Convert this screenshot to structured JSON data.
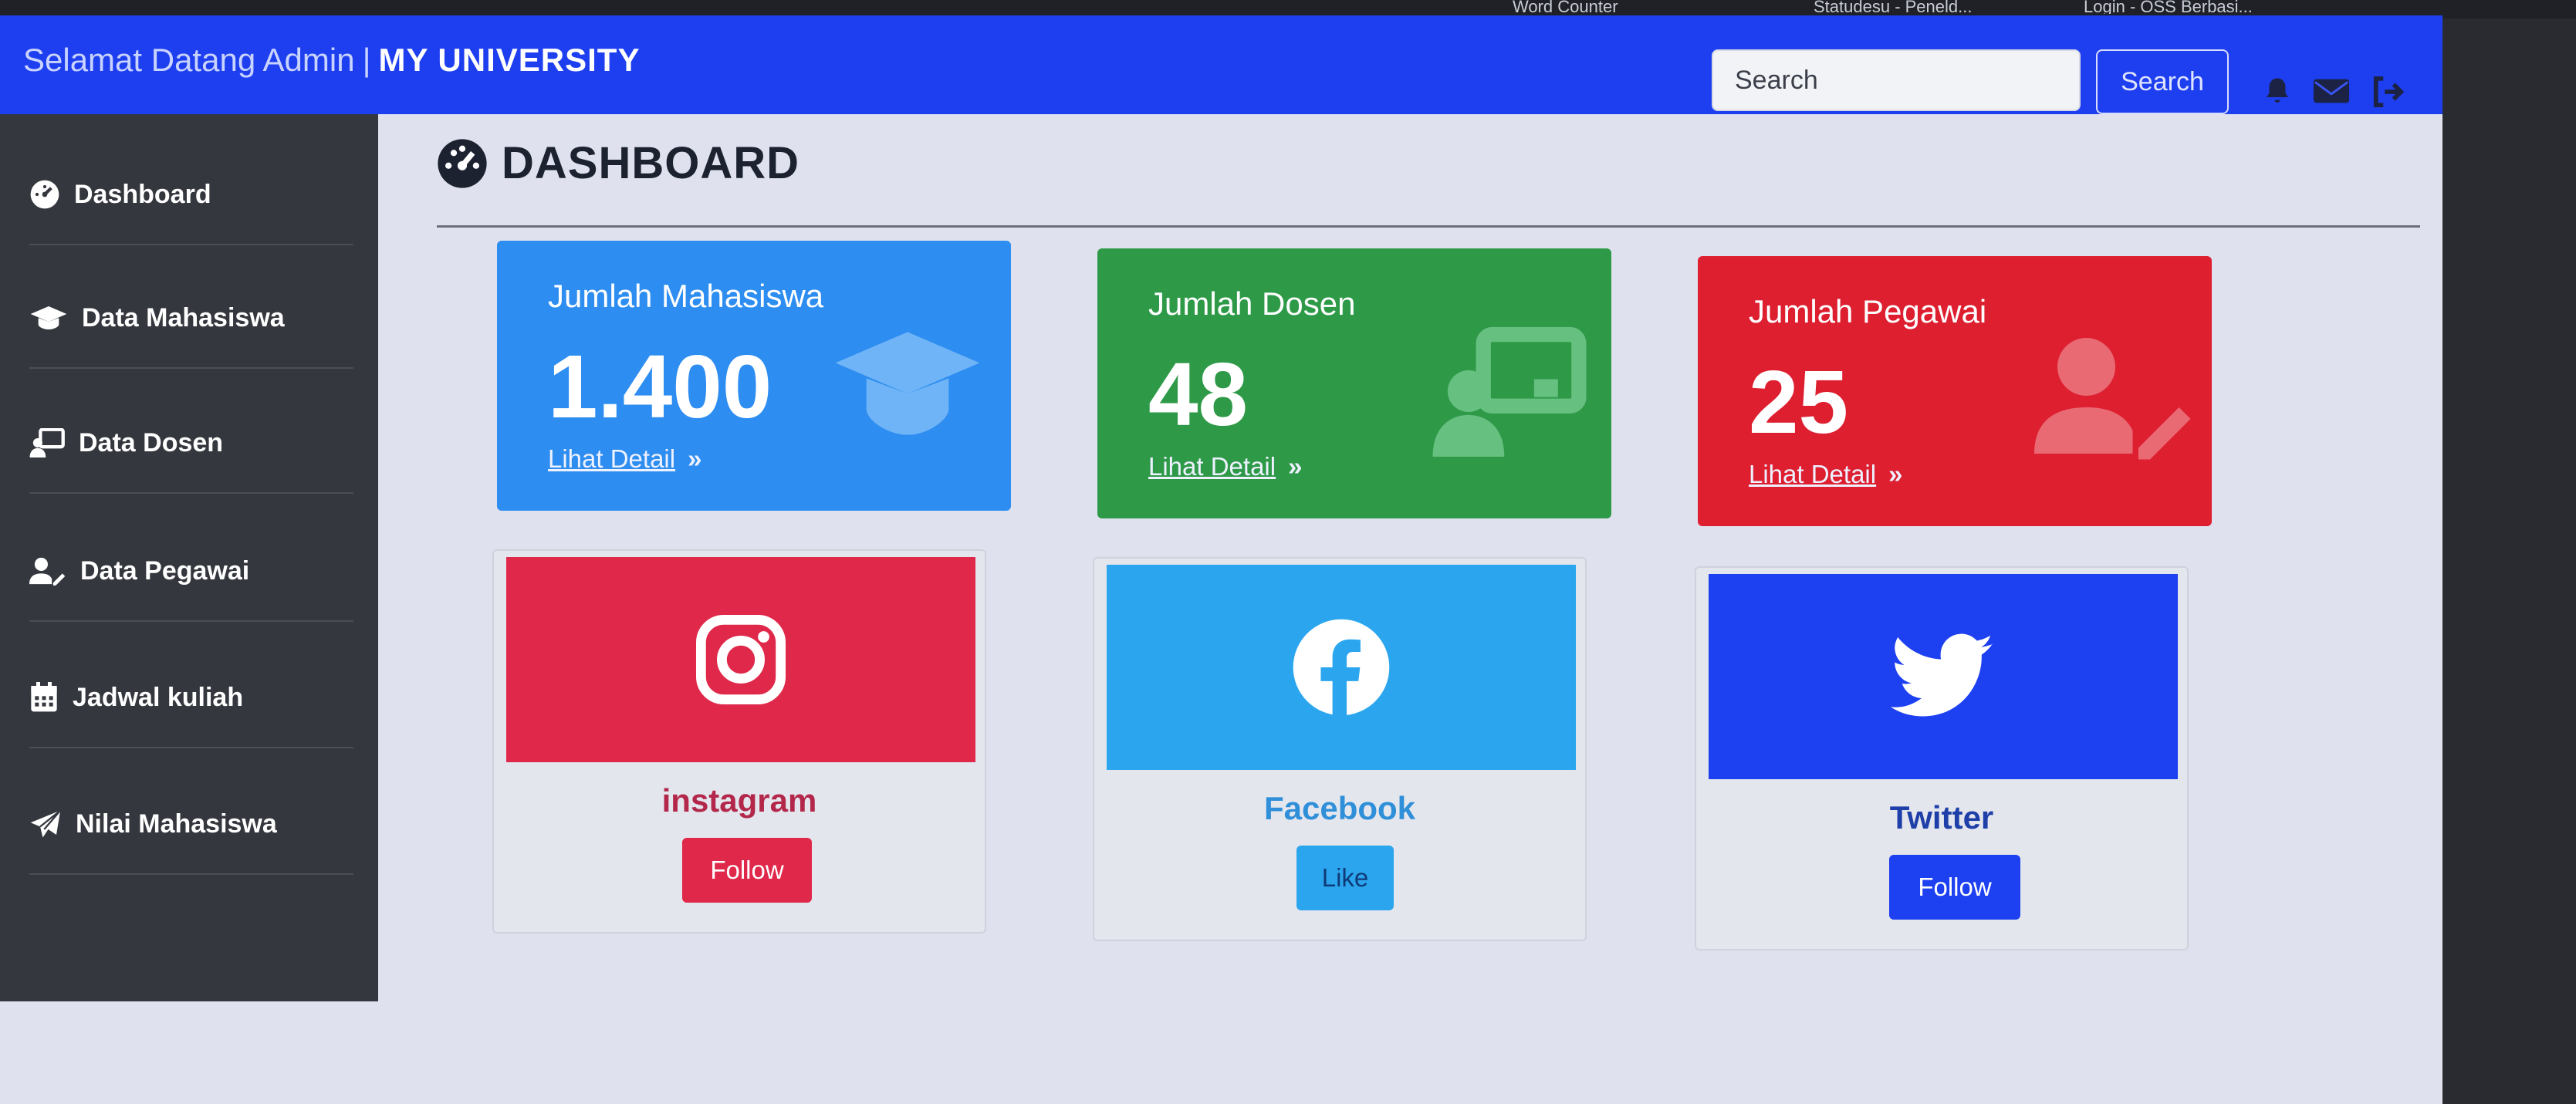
{
  "browser": {
    "bookmarks": [
      "Word Counter",
      "Statudesu - Peneld...",
      "Login - OSS Berbasi..."
    ]
  },
  "navbar": {
    "greeting": "Selamat Datang Admin",
    "separator": "|",
    "university": "MY UNIVERSITY",
    "search_placeholder": "Search",
    "search_button": "Search",
    "icons": [
      "bell-icon",
      "envelope-icon",
      "logout-icon"
    ],
    "color": "#1e3ff0"
  },
  "sidebar": {
    "items": [
      {
        "label": "Dashboard",
        "icon": "gauge-icon"
      },
      {
        "label": "Data Mahasiswa",
        "icon": "graduation-cap-icon"
      },
      {
        "label": "Data Dosen",
        "icon": "chalkboard-teacher-icon"
      },
      {
        "label": "Data Pegawai",
        "icon": "user-edit-icon"
      },
      {
        "label": "Jadwal kuliah",
        "icon": "calendar-icon"
      },
      {
        "label": "Nilai Mahasiswa",
        "icon": "paper-plane-icon"
      }
    ]
  },
  "main": {
    "title": "DASHBOARD",
    "stats": [
      {
        "label": "Jumlah Mahasiswa",
        "value": "1.400",
        "detail": "Lihat Detail",
        "color": "#2d8df0",
        "icon": "graduation-cap-icon"
      },
      {
        "label": "Jumlah Dosen",
        "value": "48",
        "detail": "Lihat Detail",
        "color": "#2e9a48",
        "icon": "chalkboard-teacher-icon"
      },
      {
        "label": "Jumlah Pegawai",
        "value": "25",
        "detail": "Lihat Detail",
        "color": "#dd1f30",
        "icon": "user-edit-icon"
      }
    ],
    "socials": [
      {
        "name": "instagram",
        "button": "Follow",
        "color": "#e0284a",
        "icon": "instagram-icon"
      },
      {
        "name": "Facebook",
        "button": "Like",
        "color": "#2ba6ee",
        "icon": "facebook-icon"
      },
      {
        "name": "Twitter",
        "button": "Follow",
        "color": "#1d40f0",
        "icon": "twitter-icon"
      }
    ]
  }
}
